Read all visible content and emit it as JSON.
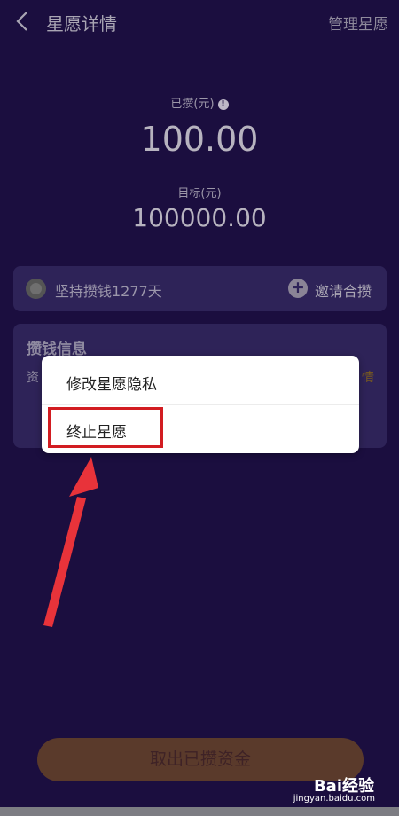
{
  "header": {
    "title": "星愿详情",
    "manage_label": "管理星愿"
  },
  "summary": {
    "saved_label": "已攒(元)",
    "saved_amount": "100.00",
    "target_label": "目标(元)",
    "target_amount": "100000.00"
  },
  "streak": {
    "text": "坚持攒钱1277天",
    "invite_label": "邀请合攒"
  },
  "info_card": {
    "title": "攒钱信息",
    "sub_partial": "资",
    "link_partial": "情"
  },
  "menu": {
    "items": [
      "修改星愿隐私",
      "终止星愿"
    ]
  },
  "withdraw": {
    "label": "取出已攒资金"
  },
  "watermark": {
    "text": "Bai经验",
    "sub": "jingyan.baidu.com"
  },
  "colors": {
    "background": "#1b0e3f",
    "card": "#2e2358",
    "highlight": "#d21c21",
    "arrow": "#e8333a"
  }
}
